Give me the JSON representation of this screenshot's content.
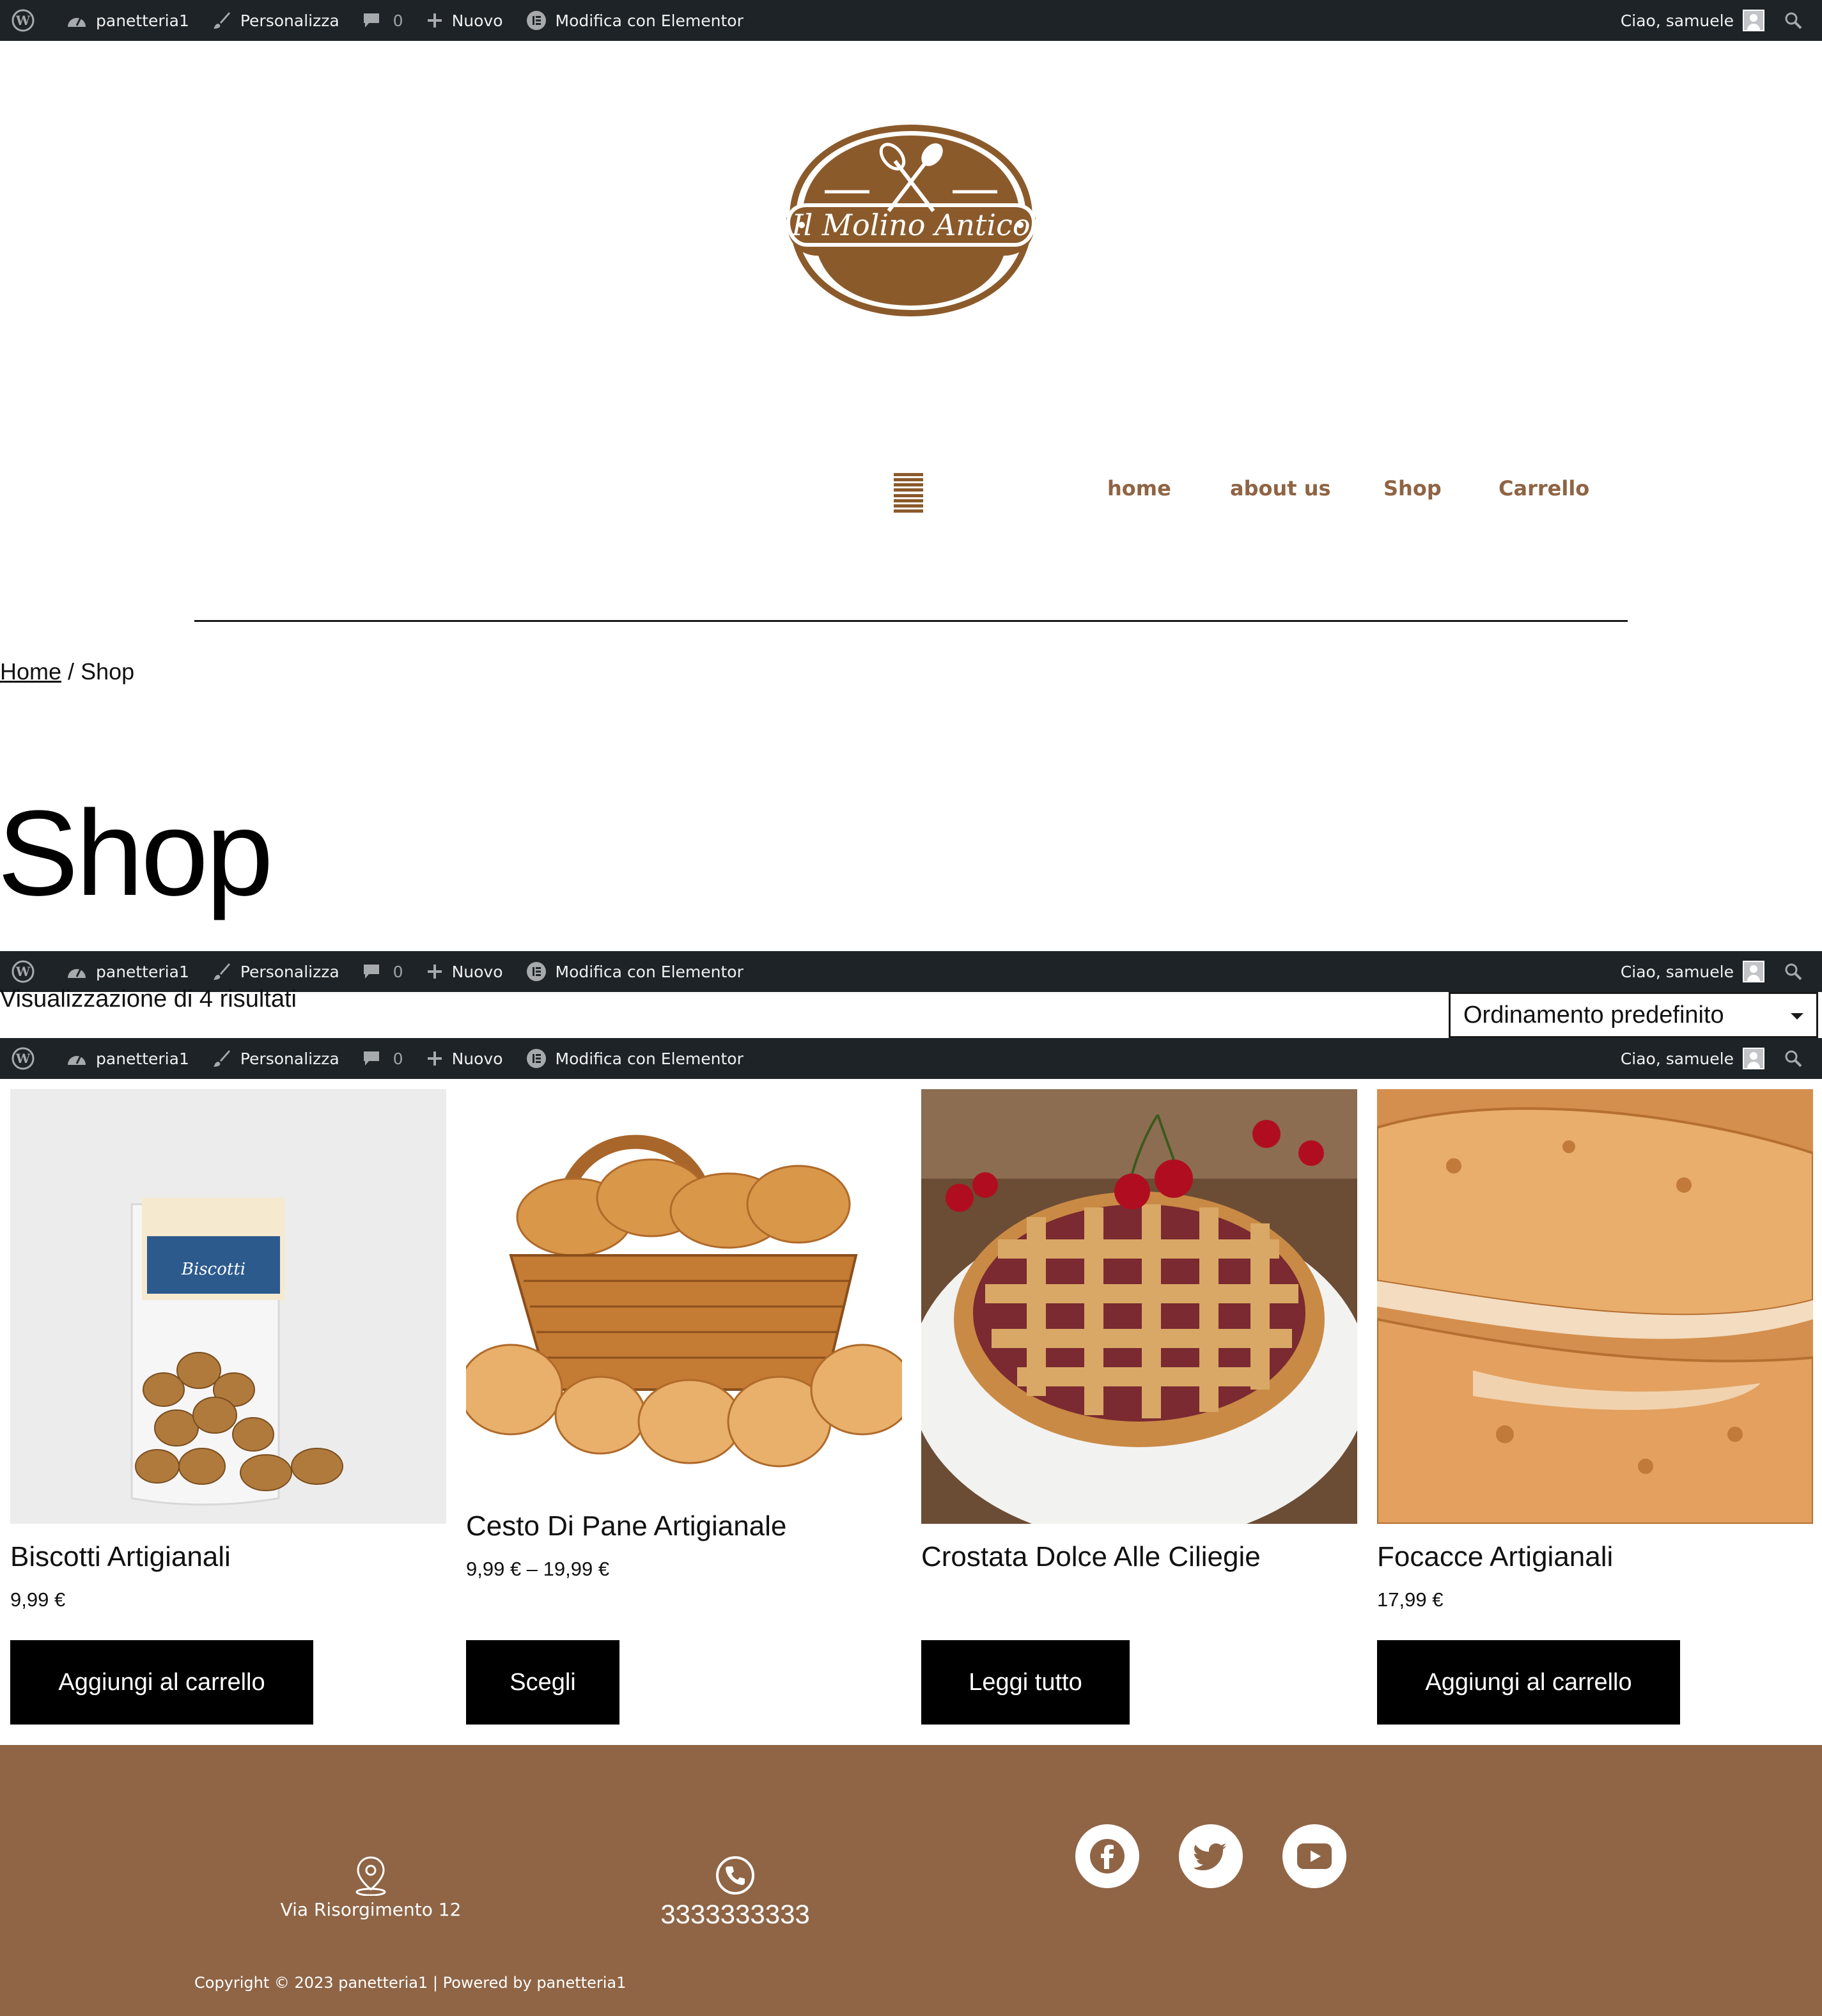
{
  "admin_bar": {
    "site_name": "panetteria1",
    "customize": "Personalizza",
    "comments_count": "0",
    "new": "Nuovo",
    "edit_elementor": "Modifica con Elementor",
    "greeting": "Ciao, samuele"
  },
  "logo": {
    "text": "Il Molino Antico"
  },
  "nav": {
    "items": [
      "home",
      "about us",
      "Shop",
      "Carrello"
    ]
  },
  "breadcrumb": {
    "home": "Home",
    "separator": "/",
    "current": "Shop"
  },
  "page_title": "Shop",
  "results": {
    "count_text": "Visualizzazione di 4 risultati",
    "order_selected": "Ordinamento predefinito"
  },
  "products": [
    {
      "name": "Biscotti Artigianali",
      "price": "9,99 €",
      "button": "Aggiungi al carrello"
    },
    {
      "name": "Cesto Di Pane Artigianale",
      "price": "9,99 € – 19,99 €",
      "button": "Scegli"
    },
    {
      "name": "Crostata Dolce Alle Ciliegie",
      "price": "",
      "button": "Leggi tutto"
    },
    {
      "name": "Focacce Artigianali",
      "price": "17,99 €",
      "button": "Aggiungi al carrello"
    }
  ],
  "footer": {
    "address": "Via Risorgimento 12",
    "phone": "3333333333",
    "copyright": "Copyright © 2023 panetteria1 | Powered by panetteria1"
  },
  "colors": {
    "brand_brown": "#8f6546",
    "admin_bar": "#1d2327",
    "button": "#000000"
  },
  "icons": [
    "wordpress-icon",
    "dashboard-icon",
    "brush-icon",
    "comment-icon",
    "plus-icon",
    "elementor-icon",
    "search-icon",
    "hamburger-icon",
    "location-icon",
    "phone-icon",
    "facebook-icon",
    "twitter-icon",
    "youtube-icon"
  ]
}
